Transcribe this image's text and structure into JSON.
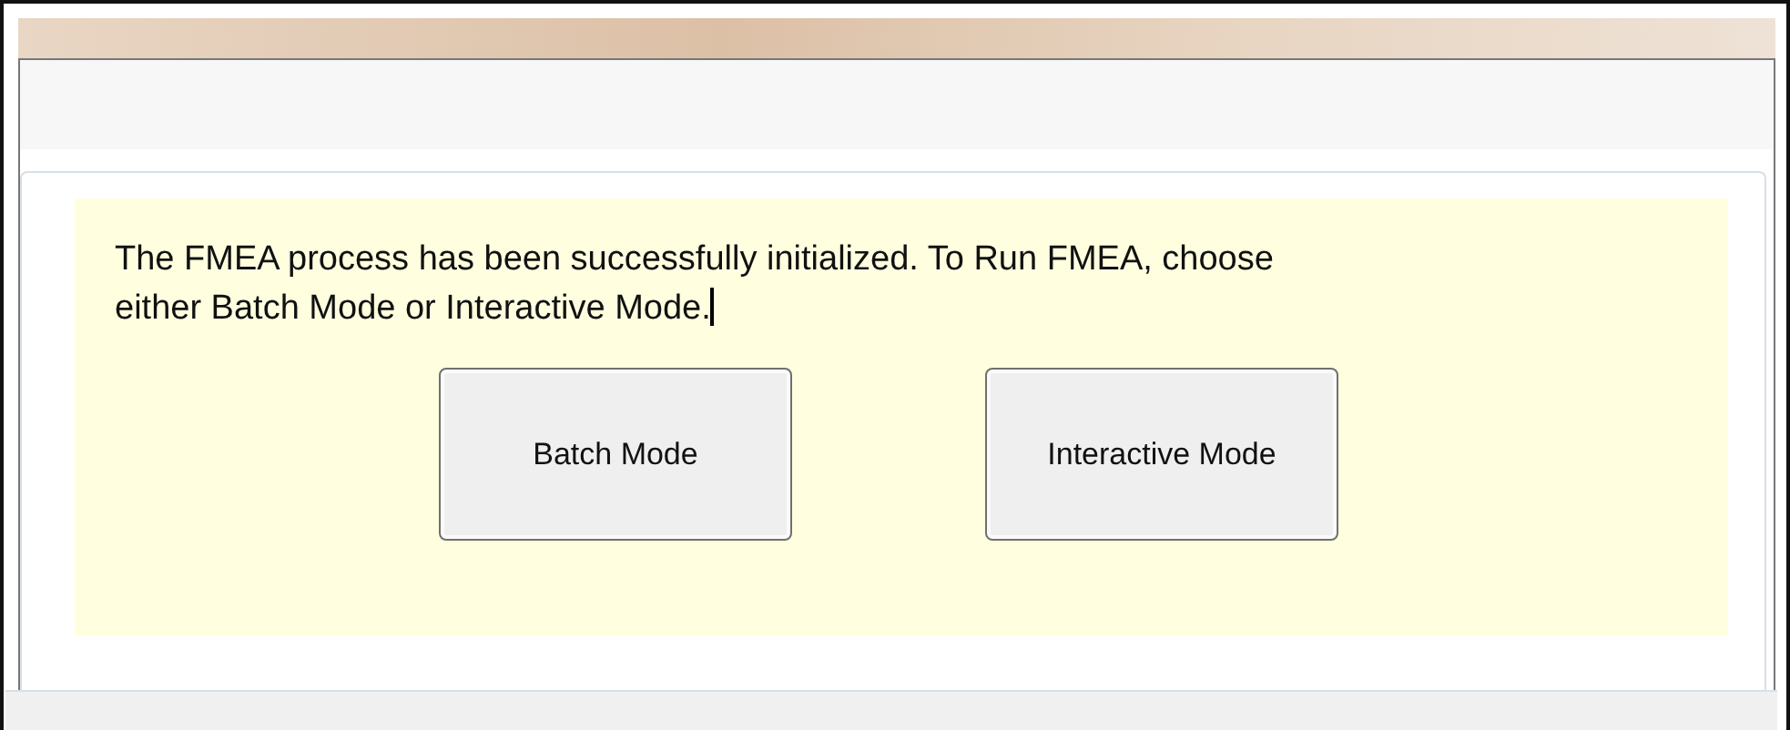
{
  "message": "The FMEA process has been successfully initialized. To Run FMEA, choose either Batch Mode or Interactive Mode.",
  "buttons": [
    {
      "label": "Batch Mode"
    },
    {
      "label": "Interactive Mode"
    }
  ]
}
